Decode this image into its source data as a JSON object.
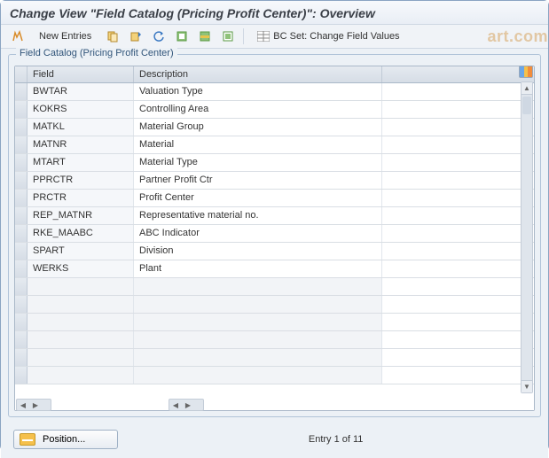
{
  "title": "Change View \"Field Catalog (Pricing Profit Center)\": Overview",
  "toolbar": {
    "new_entries": "New Entries",
    "bcset": "BC Set: Change Field Values"
  },
  "group_title": "Field Catalog (Pricing Profit Center)",
  "columns": {
    "field": "Field",
    "desc": "Description"
  },
  "rows": [
    {
      "field": "BWTAR",
      "desc": "Valuation Type"
    },
    {
      "field": "KOKRS",
      "desc": "Controlling Area"
    },
    {
      "field": "MATKL",
      "desc": "Material Group"
    },
    {
      "field": "MATNR",
      "desc": "Material"
    },
    {
      "field": "MTART",
      "desc": "Material Type"
    },
    {
      "field": "PPRCTR",
      "desc": "Partner Profit Ctr"
    },
    {
      "field": "PRCTR",
      "desc": "Profit Center"
    },
    {
      "field": "REP_MATNR",
      "desc": "Representative material no."
    },
    {
      "field": "RKE_MAABC",
      "desc": "ABC Indicator"
    },
    {
      "field": "SPART",
      "desc": "Division"
    },
    {
      "field": "WERKS",
      "desc": "Plant"
    }
  ],
  "footer": {
    "position": "Position...",
    "entry": "Entry 1 of 11"
  },
  "icons": {
    "other_view": "toggle-other-view-icon",
    "copy": "copy-icon",
    "delete": "delete-icon",
    "undo": "undo-icon",
    "select_all": "select-all-icon",
    "select_block": "select-block-icon",
    "deselect_all": "deselect-all-icon"
  }
}
